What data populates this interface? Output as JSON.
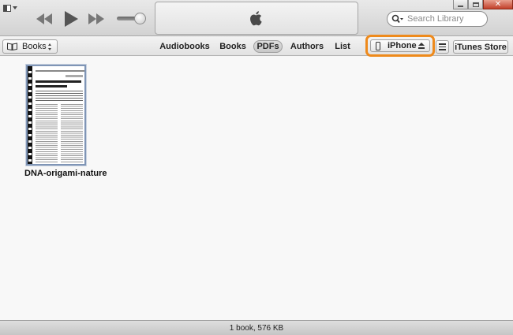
{
  "player": {
    "buttons": [
      "rewind-icon",
      "play-icon",
      "fast-forward-icon"
    ],
    "volume_level": 0.8,
    "display_icon": "apple-logo-icon"
  },
  "search": {
    "placeholder": "Search Library",
    "value": ""
  },
  "window_controls": [
    "minimize-icon",
    "maximize-icon",
    "close-icon"
  ],
  "navbar": {
    "library_selector": "Books",
    "tabs": [
      {
        "label": "Audiobooks",
        "selected": false
      },
      {
        "label": "Books",
        "selected": false
      },
      {
        "label": "PDFs",
        "selected": true
      },
      {
        "label": "Authors",
        "selected": false
      },
      {
        "label": "List",
        "selected": false
      }
    ],
    "device_name": "iPhone",
    "store_label": "iTunes Store"
  },
  "library": {
    "items": [
      {
        "title": "DNA-origami-nature",
        "type": "pdf"
      }
    ]
  },
  "status": {
    "summary": "1 book, 576 KB"
  },
  "colors": {
    "highlight": "#ee8a1c",
    "cover_selection": "#7f95b6"
  }
}
